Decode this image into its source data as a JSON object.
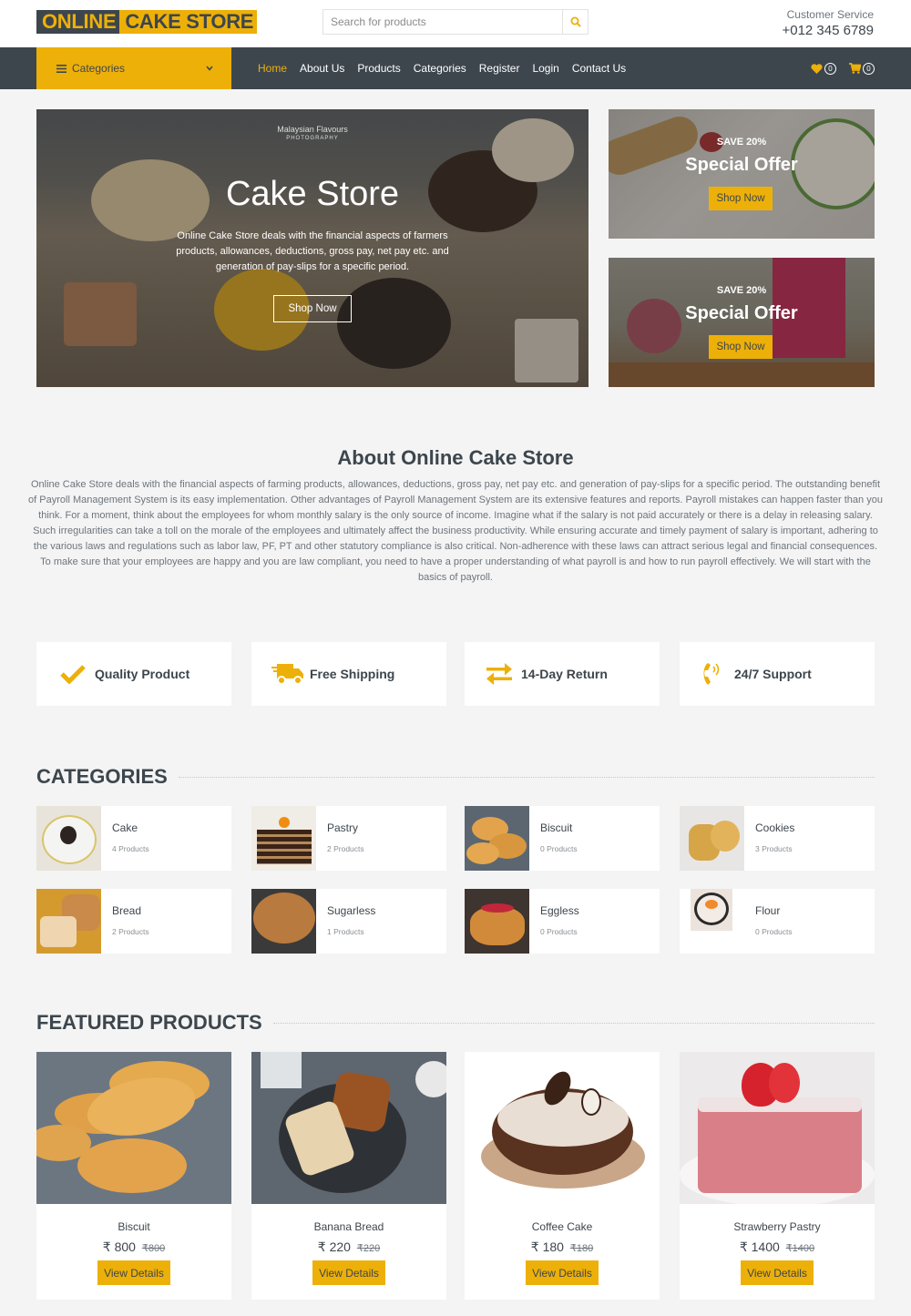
{
  "header": {
    "logo_part1": "ONLINE",
    "logo_part2": "CAKE STORE",
    "search_placeholder": "Search for products",
    "search_icon": "search-icon",
    "customer_service_label": "Customer Service",
    "customer_service_phone": "+012 345 6789"
  },
  "navbar": {
    "categories_label": "Categories",
    "links": [
      {
        "label": "Home",
        "active": true
      },
      {
        "label": "About Us"
      },
      {
        "label": "Products"
      },
      {
        "label": "Categories"
      },
      {
        "label": "Register"
      },
      {
        "label": "Login"
      },
      {
        "label": "Contact Us"
      }
    ],
    "wishlist_count": "0",
    "cart_count": "0"
  },
  "hero": {
    "watermark_line1": "Malaysian Flavours",
    "watermark_line2": "PHOTOGRAPHY",
    "title": "Cake Store",
    "description": "Online Cake Store deals with the financial aspects of farmers products, allowances, deductions, gross pay, net pay etc. and generation of pay-slips for a specific period.",
    "button_label": "Shop Now"
  },
  "offers": [
    {
      "save": "SAVE 20%",
      "title": "Special Offer",
      "button": "Shop Now"
    },
    {
      "save": "SAVE 20%",
      "title": "Special Offer",
      "button": "Shop Now"
    }
  ],
  "about": {
    "title": "About Online Cake Store",
    "text": "Online Cake Store deals with the financial aspects of farming products, allowances, deductions, gross pay, net pay etc. and generation of pay-slips for a specific period. The outstanding benefit of Payroll Management System is its easy implementation. Other advantages of Payroll Management System are its extensive features and reports. Payroll mistakes can happen faster than you think. For a moment, think about the employees for whom monthly salary is the only source of income. Imagine what if the salary is not paid accurately or there is a delay in releasing salary. Such irregularities can take a toll on the morale of the employees and ultimately affect the business productivity. While ensuring accurate and timely payment of salary is important, adhering to the various laws and regulations such as labor law, PF, PT and other statutory compliance is also critical. Non-adherence with these laws can attract serious legal and financial consequences. To make sure that your employees are happy and you are law compliant, you need to have a proper understanding of what payroll is and how to run payroll effectively. We will start with the basics of payroll."
  },
  "features": [
    {
      "icon": "check-icon",
      "label": "Quality Product"
    },
    {
      "icon": "shipping-truck-icon",
      "label": "Free Shipping"
    },
    {
      "icon": "exchange-arrows-icon",
      "label": "14-Day Return"
    },
    {
      "icon": "phone-volume-icon",
      "label": "24/7 Support"
    }
  ],
  "categories": {
    "title": "CATEGORIES",
    "items": [
      {
        "name": "Cake",
        "count": "4 Products"
      },
      {
        "name": "Pastry",
        "count": "2 Products"
      },
      {
        "name": "Biscuit",
        "count": "0 Products"
      },
      {
        "name": "Cookies",
        "count": "3 Products"
      },
      {
        "name": "Bread",
        "count": "2 Products"
      },
      {
        "name": "Sugarless",
        "count": "1 Products"
      },
      {
        "name": "Eggless",
        "count": "0 Products"
      },
      {
        "name": "Flour",
        "count": "0 Products"
      }
    ]
  },
  "featured": {
    "title": "FEATURED PRODUCTS",
    "products": [
      {
        "name": "Biscuit",
        "price": "₹ 800",
        "old_price": "₹800",
        "button": "View Details"
      },
      {
        "name": "Banana Bread",
        "price": "₹ 220",
        "old_price": "₹220",
        "button": "View Details"
      },
      {
        "name": "Coffee Cake",
        "price": "₹ 180",
        "old_price": "₹180",
        "button": "View Details"
      },
      {
        "name": "Strawberry Pastry",
        "price": "₹ 1400",
        "old_price": "₹1400",
        "button": "View Details"
      }
    ]
  },
  "colors": {
    "accent": "#edb009",
    "dark": "#3d464d",
    "background": "#f4f4f4"
  }
}
